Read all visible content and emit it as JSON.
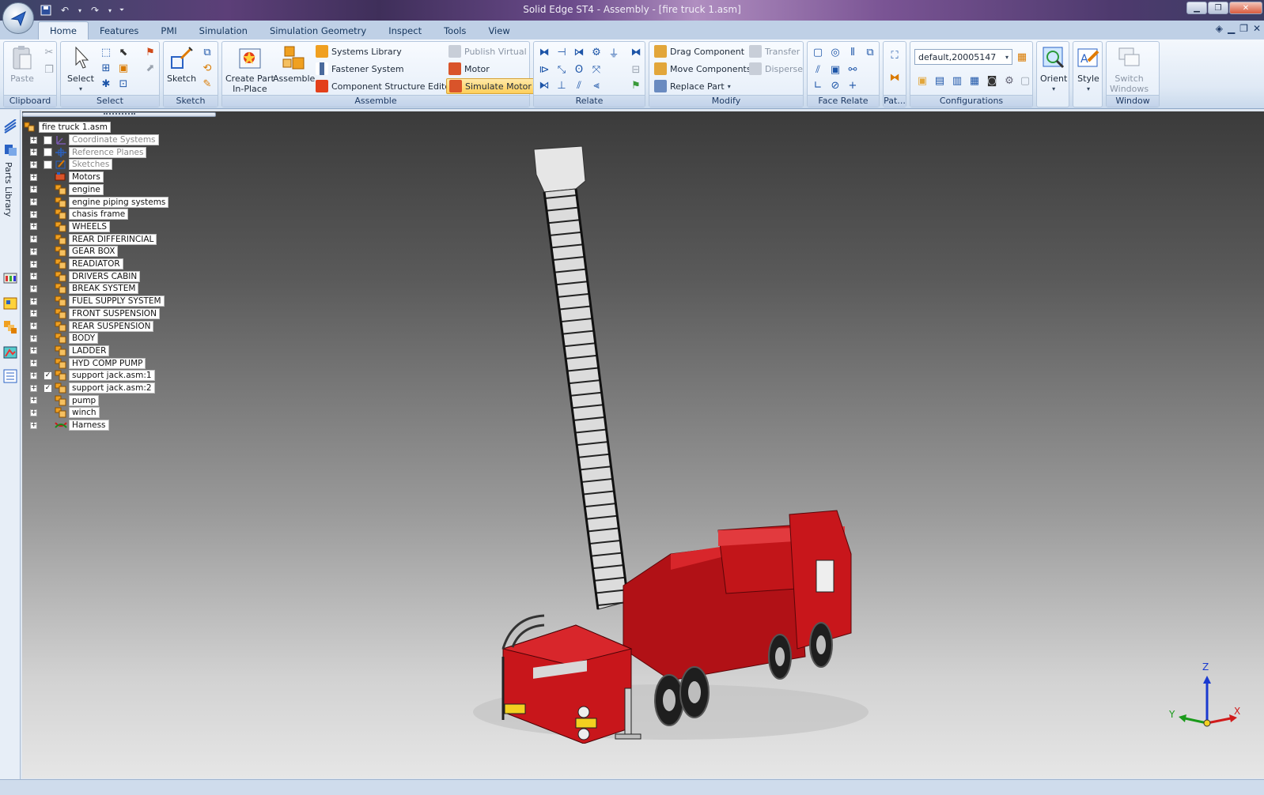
{
  "window": {
    "title": "Solid Edge ST4 - Assembly - [fire truck 1.asm]"
  },
  "tabs": [
    {
      "label": "Home",
      "active": true
    },
    {
      "label": "Features"
    },
    {
      "label": "PMI"
    },
    {
      "label": "Simulation"
    },
    {
      "label": "Simulation Geometry"
    },
    {
      "label": "Inspect"
    },
    {
      "label": "Tools"
    },
    {
      "label": "View"
    }
  ],
  "ribbon": {
    "clipboard": {
      "label": "Clipboard",
      "paste": "Paste"
    },
    "select": {
      "label": "Select",
      "select": "Select"
    },
    "sketch": {
      "label": "Sketch",
      "sketch": "Sketch"
    },
    "assemble": {
      "label": "Assemble",
      "create_part_line1": "Create Part",
      "create_part_line2": "In-Place",
      "assemble": "Assemble",
      "systems_library": "Systems Library",
      "fastener_system": "Fastener System",
      "component_structure_editor": "Component Structure Editor",
      "publish_virtual": "Publish Virtual",
      "motor": "Motor",
      "simulate_motor": "Simulate Motor"
    },
    "relate": {
      "label": "Relate"
    },
    "modify": {
      "label": "Modify",
      "drag_component": "Drag Component",
      "move_components": "Move Components",
      "replace_part": "Replace Part",
      "transfer": "Transfer",
      "disperse": "Disperse"
    },
    "face_relate": {
      "label": "Face Relate"
    },
    "pattern": {
      "label": "Pat..."
    },
    "configurations": {
      "label": "Configurations",
      "combo_value": "default,20005147"
    },
    "orient": {
      "label": "Orient"
    },
    "style": {
      "label": "Style"
    },
    "window": {
      "label": "Window",
      "switch_line1": "Switch",
      "switch_line2": "Windows"
    }
  },
  "left_strip": {
    "parts_library": "Parts Library"
  },
  "tree": {
    "root": "fire truck 1.asm",
    "nodes": [
      {
        "label": "Coordinate Systems",
        "dim": true,
        "checkbox": "empty",
        "icon": "coordinate-system-icon"
      },
      {
        "label": "Reference Planes",
        "dim": true,
        "checkbox": "empty",
        "icon": "reference-plane-icon"
      },
      {
        "label": "Sketches",
        "dim": true,
        "checkbox": "empty",
        "icon": "sketch-icon"
      },
      {
        "label": "Motors",
        "icon": "motor-icon"
      },
      {
        "label": "engine",
        "icon": "assembly-icon"
      },
      {
        "label": "engine piping systems",
        "icon": "assembly-icon"
      },
      {
        "label": "chasis frame",
        "icon": "assembly-icon"
      },
      {
        "label": "WHEELS",
        "icon": "assembly-icon"
      },
      {
        "label": "REAR DIFFERINCIAL",
        "icon": "assembly-icon"
      },
      {
        "label": "GEAR BOX",
        "icon": "assembly-icon"
      },
      {
        "label": "READIATOR",
        "icon": "assembly-icon"
      },
      {
        "label": "DRIVERS CABIN",
        "icon": "assembly-icon"
      },
      {
        "label": "BREAK SYSTEM",
        "icon": "assembly-icon"
      },
      {
        "label": "FUEL SUPPLY SYSTEM",
        "icon": "assembly-icon"
      },
      {
        "label": "FRONT SUSPENSION",
        "icon": "assembly-icon"
      },
      {
        "label": "REAR SUSPENSION",
        "icon": "assembly-icon"
      },
      {
        "label": "BODY",
        "icon": "assembly-icon"
      },
      {
        "label": "LADDER",
        "icon": "assembly-icon"
      },
      {
        "label": "HYD COMP PUMP",
        "icon": "assembly-icon"
      },
      {
        "label": "support jack.asm:1",
        "checkbox": "checked",
        "icon": "assembly-icon"
      },
      {
        "label": "support jack.asm:2",
        "checkbox": "checked",
        "icon": "assembly-icon"
      },
      {
        "label": "pump",
        "icon": "assembly-icon"
      },
      {
        "label": "winch",
        "icon": "assembly-icon"
      },
      {
        "label": "Harness",
        "icon": "harness-icon"
      }
    ]
  },
  "triad": {
    "x": "X",
    "y": "Y",
    "z": "Z"
  },
  "colors": {
    "truck_red": "#c8161b",
    "highlight": "#ffcf5a",
    "ribbon_blue": "#1e3a64"
  }
}
